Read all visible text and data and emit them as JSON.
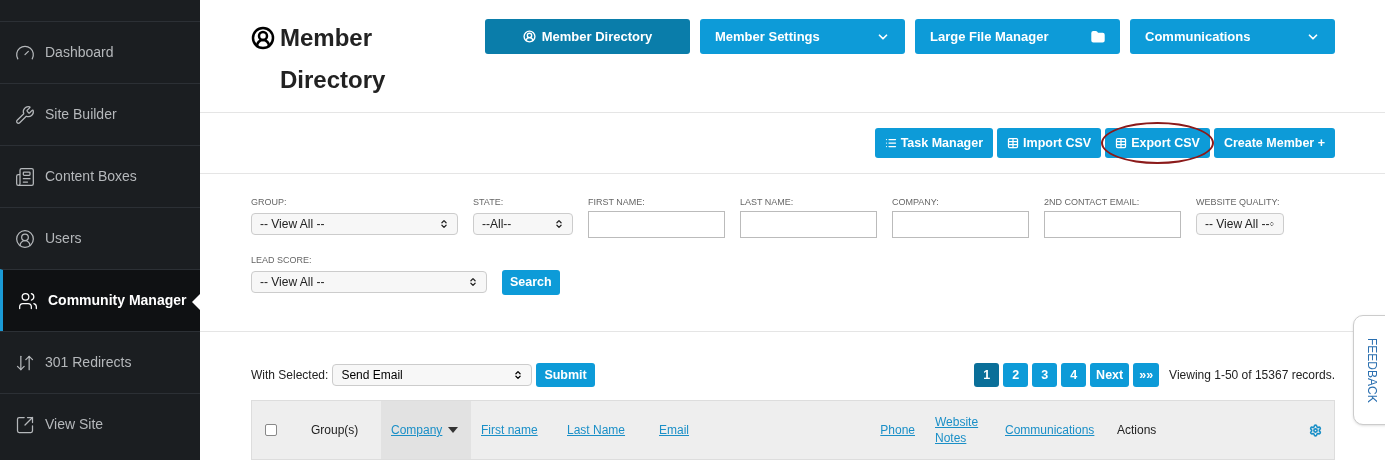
{
  "sidebar": {
    "items": [
      {
        "label": "Dashboard",
        "selected": false
      },
      {
        "label": "Site Builder",
        "selected": false
      },
      {
        "label": "Content Boxes",
        "selected": false
      },
      {
        "label": "Users",
        "selected": false
      },
      {
        "label": "Community Manager",
        "selected": true
      },
      {
        "label": "301 Redirects",
        "selected": false
      },
      {
        "label": "View Site",
        "selected": false
      }
    ]
  },
  "page_title": "Member Directory",
  "nav_buttons": [
    {
      "label": "Member Directory",
      "selected": true
    },
    {
      "label": "Member Settings",
      "selected": false
    },
    {
      "label": "Large File Manager",
      "selected": false
    },
    {
      "label": "Communications",
      "selected": false
    }
  ],
  "actions": [
    {
      "label": "Task Manager",
      "circled": false
    },
    {
      "label": "Import CSV",
      "circled": false
    },
    {
      "label": "Export CSV",
      "circled": true
    },
    {
      "label": "Create Member +",
      "circled": false
    }
  ],
  "filters": [
    {
      "label": "GROUP:",
      "kind": "select",
      "value": "-- View All --"
    },
    {
      "label": "STATE:",
      "kind": "select",
      "value": "--All--"
    },
    {
      "label": "FIRST NAME:",
      "kind": "text"
    },
    {
      "label": "LAST NAME:",
      "kind": "text"
    },
    {
      "label": "COMPANY:",
      "kind": "text"
    },
    {
      "label": "2ND CONTACT EMAIL:",
      "kind": "text"
    },
    {
      "label": "WEBSITE QUALITY:",
      "kind": "select",
      "value": "-- View All --"
    },
    {
      "label": "LEAD SCORE:",
      "kind": "select",
      "value": "-- View All --"
    }
  ],
  "search_button": "Search",
  "bulk": {
    "label": "With Selected:",
    "value": "Send Email",
    "submit": "Submit"
  },
  "pagination": [
    {
      "label": "1",
      "selected": true
    },
    {
      "label": "2",
      "selected": false
    },
    {
      "label": "3",
      "selected": false
    },
    {
      "label": "4",
      "selected": false
    },
    {
      "label": "Next",
      "selected": false
    },
    {
      "label": "»»",
      "selected": false
    }
  ],
  "records": "Viewing 1-50 of 15367 records.",
  "table": {
    "select_all": {
      "checked": false
    },
    "columns": [
      {
        "label": "Group(s)",
        "kind": "text",
        "sorted": false
      },
      {
        "label": "Company",
        "kind": "link",
        "sorted": true
      },
      {
        "label": "First name",
        "kind": "link",
        "sorted": false
      },
      {
        "label": "Last Name",
        "kind": "link",
        "sorted": false
      },
      {
        "label": "Email",
        "kind": "link",
        "sorted": false
      },
      {
        "label": "Phone",
        "kind": "link",
        "sorted": false
      },
      {
        "label": "Website Notes",
        "kind": "link",
        "sorted": false
      },
      {
        "label": "Communications",
        "kind": "link",
        "sorted": false
      },
      {
        "label": "Actions",
        "kind": "text",
        "sorted": false
      }
    ]
  },
  "feedback": "FEEDBACK"
}
